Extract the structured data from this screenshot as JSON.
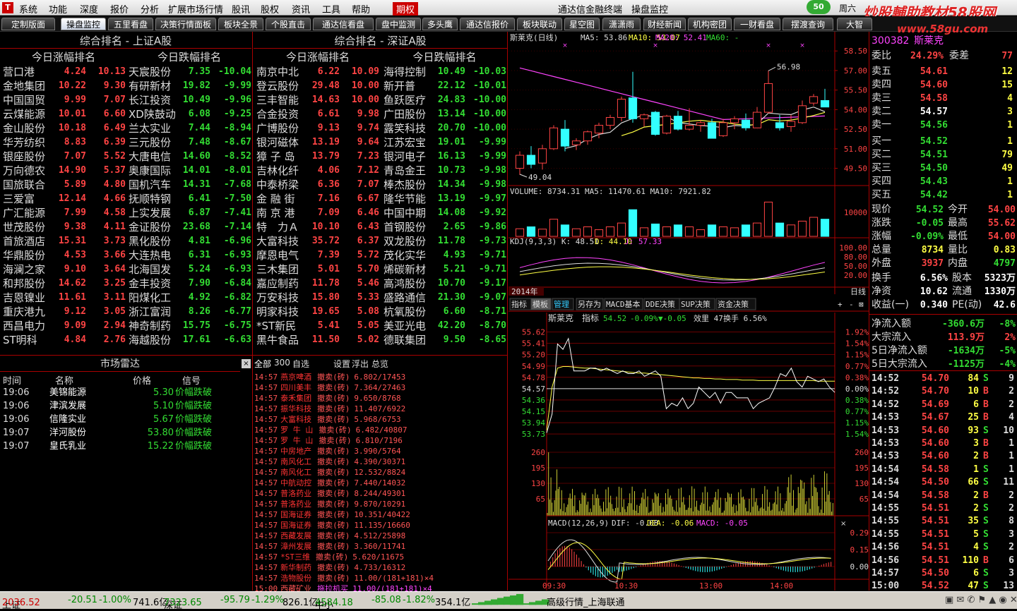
{
  "menu": {
    "items": [
      "系统",
      "功能",
      "深度",
      "报价",
      "分析",
      "扩展市场行情",
      "股讯",
      "股权",
      "资讯",
      "工具",
      "帮助",
      "期权"
    ],
    "app_title": "通达信金融终端",
    "module_title": "操盘监控",
    "weekday": "周六",
    "badge": "50"
  },
  "watermark": {
    "line1": "炒股輔助教材58股网",
    "line2": "www.58gu.com"
  },
  "tabs": [
    "定制版面",
    "操盘监控",
    "五里看盘",
    "决策行情面板",
    "板块全景",
    "个股直击",
    "通达信看盘",
    "盘中监测",
    "多头鹰",
    "通达信报价",
    "板块联动",
    "星空图",
    "潇潇雨",
    "财经新闻",
    "机构密团",
    "一财看盘",
    "摆渡查询",
    "大智"
  ],
  "sh_panel": {
    "title": "综合排名 - 上证A股",
    "gainers_head": "今日涨幅排名",
    "losers_head": "今日跌幅排名",
    "gainers": [
      [
        "营口港",
        "4.24",
        "10.13"
      ],
      [
        "金地集团",
        "10.22",
        "9.30"
      ],
      [
        "中国国贸",
        "9.99",
        "7.07"
      ],
      [
        "云煤能源",
        "10.01",
        "6.60"
      ],
      [
        "金山股份",
        "10.18",
        "6.49"
      ],
      [
        "华芳纺织",
        "8.83",
        "6.39"
      ],
      [
        "银座股份",
        "7.07",
        "5.52"
      ],
      [
        "万向德农",
        "14.90",
        "5.37"
      ],
      [
        "国旅联合",
        "5.89",
        "4.80"
      ],
      [
        "三爱富",
        "12.14",
        "4.66"
      ],
      [
        "广汇能源",
        "7.99",
        "4.58"
      ],
      [
        "世茂股份",
        "9.38",
        "4.11"
      ],
      [
        "首旅酒店",
        "15.31",
        "3.73"
      ],
      [
        "华鼎股份",
        "4.53",
        "3.66"
      ],
      [
        "海澜之家",
        "9.10",
        "3.64"
      ],
      [
        "和邦股份",
        "14.62",
        "3.25"
      ],
      [
        "吉恩镍业",
        "11.61",
        "3.11"
      ],
      [
        "重庆港九",
        "9.12",
        "3.05"
      ],
      [
        "西昌电力",
        "9.09",
        "2.94"
      ],
      [
        "ST明科",
        "4.84",
        "2.76"
      ]
    ],
    "losers": [
      [
        "天宸股份",
        "7.35",
        "-10.04"
      ],
      [
        "有研新材",
        "19.82",
        "-9.99"
      ],
      [
        "长江投资",
        "10.49",
        "-9.96"
      ],
      [
        "XD陕鼓动",
        "6.08",
        "-9.25"
      ],
      [
        "兰太实业",
        "7.44",
        "-8.94"
      ],
      [
        "三元股份",
        "7.48",
        "-8.67"
      ],
      [
        "大唐电信",
        "14.60",
        "-8.52"
      ],
      [
        "奥康国际",
        "14.01",
        "-8.01"
      ],
      [
        "国机汽车",
        "14.31",
        "-7.68"
      ],
      [
        "抚顺特钢",
        "6.41",
        "-7.50"
      ],
      [
        "上实发展",
        "6.87",
        "-7.41"
      ],
      [
        "金证股份",
        "23.68",
        "-7.14"
      ],
      [
        "黑化股份",
        "4.81",
        "-6.96"
      ],
      [
        "大连热电",
        "6.31",
        "-6.93"
      ],
      [
        "北海国发",
        "5.24",
        "-6.93"
      ],
      [
        "金丰投资",
        "7.90",
        "-6.84"
      ],
      [
        "阳煤化工",
        "4.92",
        "-6.82"
      ],
      [
        "浙江富润",
        "8.26",
        "-6.77"
      ],
      [
        "神奇制药",
        "15.75",
        "-6.75"
      ],
      [
        "海越股份",
        "17.61",
        "-6.63"
      ]
    ]
  },
  "sz_panel": {
    "title": "综合排名 - 深证A股",
    "gainers_head": "今日涨幅排名",
    "losers_head": "今日跌幅排名",
    "gainers": [
      [
        "南京中北",
        "6.22",
        "10.09"
      ],
      [
        "登云股份",
        "29.48",
        "10.00"
      ],
      [
        "三丰智能",
        "14.63",
        "10.00"
      ],
      [
        "合金投资",
        "6.61",
        "9.98"
      ],
      [
        "广博股份",
        "9.13",
        "9.74"
      ],
      [
        "银河磁体",
        "13.19",
        "9.64"
      ],
      [
        "獐 子 岛",
        "13.79",
        "7.23"
      ],
      [
        "吉林化纤",
        "4.06",
        "7.12"
      ],
      [
        "中泰桥梁",
        "6.36",
        "7.07"
      ],
      [
        "金 融 街",
        "7.16",
        "6.67"
      ],
      [
        "南 京 港",
        "7.09",
        "6.46"
      ],
      [
        "特　力Ａ",
        "10.10",
        "6.43"
      ],
      [
        "大富科技",
        "35.72",
        "6.37"
      ],
      [
        "摩恩电气",
        "7.39",
        "5.72"
      ],
      [
        "三木集团",
        "5.01",
        "5.70"
      ],
      [
        "嘉应制药",
        "11.78",
        "5.46"
      ],
      [
        "万安科技",
        "15.80",
        "5.33"
      ],
      [
        "明家科技",
        "19.65",
        "5.08"
      ],
      [
        "*ST新民",
        "5.41",
        "5.05"
      ],
      [
        "黑牛食品",
        "11.50",
        "5.02"
      ]
    ],
    "losers": [
      [
        "海得控制",
        "10.49",
        "-10.03"
      ],
      [
        "新开普",
        "22.12",
        "-10.01"
      ],
      [
        "鱼跃医疗",
        "24.83",
        "-10.00"
      ],
      [
        "广田股份",
        "13.14",
        "-10.00"
      ],
      [
        "露笑科技",
        "20.70",
        "-10.00"
      ],
      [
        "江苏宏宝",
        "19.01",
        "-9.99"
      ],
      [
        "银河电子",
        "16.13",
        "-9.99"
      ],
      [
        "青岛金王",
        "10.73",
        "-9.98"
      ],
      [
        "棒杰股份",
        "14.34",
        "-9.98"
      ],
      [
        "隆华节能",
        "13.19",
        "-9.97"
      ],
      [
        "中国中期",
        "14.08",
        "-9.92"
      ],
      [
        "首钢股份",
        "2.65",
        "-9.86"
      ],
      [
        "双龙股份",
        "11.78",
        "-9.73"
      ],
      [
        "茂化实华",
        "4.93",
        "-9.71"
      ],
      [
        "烯碳新材",
        "5.21",
        "-9.71"
      ],
      [
        "高鸿股份",
        "10.70",
        "-9.17"
      ],
      [
        "盛路通信",
        "21.30",
        "-9.07"
      ],
      [
        "杭氧股份",
        "6.60",
        "-8.71"
      ],
      [
        "美亚光电",
        "42.20",
        "-8.70"
      ],
      [
        "德联集团",
        "9.50",
        "-8.65"
      ]
    ]
  },
  "radar": {
    "title": "市场雷达",
    "headers": [
      "时间",
      "名称",
      "价格",
      "信号"
    ],
    "rows": [
      [
        "19:06",
        "美锦能源",
        "5.30",
        "价幅跌破"
      ],
      [
        "19:06",
        "津滨发展",
        "5.10",
        "价幅跌破"
      ],
      [
        "19:06",
        "信隆实业",
        "5.67",
        "价幅跌破"
      ],
      [
        "19:07",
        "洋河股份",
        "53.80",
        "价幅跌破"
      ],
      [
        "19:07",
        "皇氏乳业",
        "15.22",
        "价幅跌破"
      ]
    ]
  },
  "tape": {
    "tabs": [
      "全部",
      "300",
      "自选",
      "设置",
      "浮出",
      "总览"
    ],
    "rows": [
      [
        "14:57",
        "燕京啤酒",
        "撤卖(砖)",
        "6.802/17453"
      ],
      [
        "14:57",
        "四川美丰",
        "撤卖(砖)",
        "7.364/27463"
      ],
      [
        "14:57",
        "泰禾集团",
        "撤卖(砖)",
        "9.650/8768"
      ],
      [
        "14:57",
        "振华科技",
        "撤卖(砖)",
        "11.407/6922"
      ],
      [
        "14:57",
        "大富科技",
        "撤卖(砖)",
        "5.968/6753"
      ],
      [
        "14:57",
        "罗 牛 山",
        "撤卖(砖)",
        "6.482/40807"
      ],
      [
        "14:57",
        "罗 牛 山",
        "撤卖(砖)",
        "6.810/7196"
      ],
      [
        "14:57",
        "中房地产",
        "撤卖(砖)",
        "3.990/5764"
      ],
      [
        "14:57",
        "南风化工",
        "撤卖(砖)",
        "4.390/30371"
      ],
      [
        "14:57",
        "南风化工",
        "撤卖(砖)",
        "12.532/8824"
      ],
      [
        "14:57",
        "中航动控",
        "撤卖(砖)",
        "7.440/14032"
      ],
      [
        "14:57",
        "普洛药业",
        "撤卖(砖)",
        "8.244/49301"
      ],
      [
        "14:57",
        "普洛药业",
        "撤卖(砖)",
        "9.870/10291"
      ],
      [
        "14:57",
        "国海证券",
        "撤卖(砖)",
        "10.351/40422"
      ],
      [
        "14:57",
        "国海证券",
        "撤卖(砖)",
        "11.135/16660"
      ],
      [
        "14:57",
        "西藏发展",
        "撤卖(砖)",
        "4.512/25898"
      ],
      [
        "14:57",
        "漳州发展",
        "撤卖(砖)",
        "3.360/11741"
      ],
      [
        "14:57",
        "*ST三维",
        "撤卖(砖)",
        "5.620/11675"
      ],
      [
        "14:57",
        "新华制药",
        "撤卖(砖)",
        "4.733/16312"
      ],
      [
        "14:57",
        "浩物股份",
        "撤卖(砖)",
        "11.00/(181+181)×4"
      ],
      [
        "15:00",
        "西藏矿业",
        "拖拉机买",
        "11.00/(181+181)×4"
      ]
    ]
  },
  "kline": {
    "header_name": "斯莱克(日线)",
    "ma5": "MA5: 53.86",
    "ma10": "MA10: 53.07",
    "ma20": "MA20: 52.41",
    "ma60": "MA60: -",
    "high_label": "56.98",
    "low_label": "49.04",
    "y_ticks": [
      "58.50",
      "57.00",
      "55.50",
      "54.00",
      "52.50",
      "51.00",
      "49.50"
    ],
    "candles": [
      [
        49.5,
        50.8,
        49.0,
        50.5
      ],
      [
        50.5,
        51.2,
        49.5,
        49.8
      ],
      [
        49.9,
        51.3,
        49.4,
        51.0
      ],
      [
        51.0,
        52.8,
        50.9,
        52.6
      ],
      [
        52.5,
        53.2,
        50.8,
        51.2
      ],
      [
        51.3,
        51.8,
        50.9,
        51.6
      ],
      [
        51.6,
        52.4,
        51.3,
        52.3
      ],
      [
        52.2,
        53.0,
        51.8,
        52.8
      ],
      [
        52.8,
        53.6,
        52.5,
        53.4
      ],
      [
        53.4,
        55.0,
        53.1,
        54.8
      ],
      [
        54.9,
        56.9,
        53.0,
        53.3
      ],
      [
        53.3,
        53.7,
        52.7,
        53.6
      ],
      [
        53.8,
        53.9,
        52.0,
        52.1
      ],
      [
        52.2,
        53.6,
        52.1,
        53.5
      ],
      [
        53.5,
        53.9,
        52.4,
        52.5
      ],
      [
        52.5,
        54.1,
        52.4,
        52.8
      ],
      [
        52.8,
        53.2,
        52.3,
        53.0
      ],
      [
        53.0,
        53.3,
        51.8,
        51.8
      ],
      [
        52.0,
        53.3,
        51.9,
        53.0
      ],
      [
        53.0,
        53.5,
        52.5,
        53.3
      ],
      [
        53.2,
        53.7,
        52.4,
        52.6
      ],
      [
        52.6,
        54.2,
        52.6,
        53.8
      ],
      [
        53.8,
        57.0,
        53.7,
        56.0
      ],
      [
        53.0,
        53.6,
        52.4,
        52.6
      ],
      [
        52.7,
        53.6,
        52.3,
        53.1
      ],
      [
        53.0,
        54.7,
        52.9,
        54.3
      ],
      [
        54.5,
        55.2,
        54.3,
        55.0
      ],
      [
        54.7,
        55.6,
        54.2,
        54.2
      ]
    ],
    "vol_header": "VOLUME: 8734.31  MA5: 11470.61  MA10: 7921.82",
    "vol_tick": "10000",
    "volumes": [
      4000,
      5000,
      3800,
      9000,
      6000,
      4000,
      5000,
      3500,
      5000,
      7000,
      14000,
      4500,
      6500,
      5000,
      6000,
      5000,
      3500,
      6000,
      5000,
      4500,
      6000,
      7000,
      18000,
      7000,
      6000,
      8000,
      10000,
      9000
    ],
    "kdj_header_k": "KDJ(9,3,3)  K: 48.51",
    "kdj_header_d": "D: 44.10",
    "kdj_header_j": "J: 57.33",
    "kdj_ticks": [
      "100.00",
      "80.00",
      "50.00",
      "20.00"
    ],
    "year_label": "2014年",
    "period": "日线"
  },
  "bottom_tabs": [
    "指标",
    "模板",
    "管理",
    "另存为",
    "MACD基本",
    "DDE决策",
    "SUP决策",
    "资金决策"
  ],
  "intraday": {
    "name": "斯莱克",
    "label": "指标",
    "price": "54.52",
    "chg": "-0.09%",
    "delta": "▼-0.05",
    "vr": "效里 47",
    "turn": "换手 6.56%",
    "left_ticks": [
      "55.62",
      "55.41",
      "55.20",
      "54.99",
      "54.78",
      "54.57",
      "54.36",
      "54.15",
      "53.94",
      "53.73"
    ],
    "right_ticks": [
      "1.92%",
      "1.54%",
      "1.15%",
      "0.77%",
      "0.38%",
      "0.00%",
      "0.38%",
      "0.77%",
      "1.15%",
      "1.54%"
    ],
    "vol_ticks": [
      "260",
      "195",
      "130",
      "65"
    ],
    "macd_header": "MACD(12,26,9)",
    "macd_dif": "DIF: -0.08",
    "macd_dea": "DEA: -0.06",
    "macd_val": "MACD: -0.05",
    "macd_ticks": [
      "0.29",
      "0.15",
      "0.00"
    ],
    "time_ticks": [
      "09:30",
      "10:30",
      "13:00",
      "14:00"
    ],
    "price_series": [
      53.75,
      54.1,
      55.4,
      55.3,
      55.5,
      54.9,
      54.9,
      54.9,
      54.95,
      54.95,
      54.9,
      54.95,
      54.9,
      54.85,
      54.9,
      54.85,
      54.85,
      54.9,
      54.8,
      54.85,
      54.9,
      54.8,
      54.2,
      54.3,
      54.25,
      54.4,
      54.2,
      54.3,
      54.6,
      54.5,
      54.4,
      54.5,
      54.3,
      54.5,
      54.5,
      54.4,
      54.4,
      54.4,
      54.2,
      54.3,
      54.35,
      54.4,
      54.6,
      54.85,
      54.8,
      54.95,
      54.7,
      54.6,
      54.8,
      54.75,
      54.7,
      54.75,
      54.6,
      54.5
    ],
    "avg_series": [
      53.8,
      54.6,
      54.95,
      54.98,
      54.98,
      54.97,
      54.96,
      54.95,
      54.95,
      54.94,
      54.93,
      54.92,
      54.91,
      54.9,
      54.89,
      54.88,
      54.87,
      54.86,
      54.86,
      54.85,
      54.84,
      54.83,
      54.82,
      54.81,
      54.8,
      54.79,
      54.78,
      54.77,
      54.77,
      54.76,
      54.76,
      54.75,
      54.75,
      54.74,
      54.74,
      54.74,
      54.73,
      54.73,
      54.73,
      54.72,
      54.72,
      54.72,
      54.72,
      54.72,
      54.72,
      54.72,
      54.72,
      54.72,
      54.72,
      54.72,
      54.71,
      54.71,
      54.71,
      54.71
    ]
  },
  "quote": {
    "code": "300382",
    "name": "斯莱克",
    "webi_label": "委比",
    "webi": "24.29%",
    "weicha_label": "委差",
    "weicha": "77",
    "asks": [
      [
        "卖五",
        "54.61",
        "12"
      ],
      [
        "卖四",
        "54.60",
        "15"
      ],
      [
        "卖三",
        "54.58",
        "4"
      ],
      [
        "卖二",
        "54.57",
        "3"
      ],
      [
        "卖一",
        "54.56",
        "1"
      ]
    ],
    "bids": [
      [
        "买一",
        "54.52",
        "1"
      ],
      [
        "买二",
        "54.51",
        "79"
      ],
      [
        "买三",
        "54.50",
        "49"
      ],
      [
        "买四",
        "54.43",
        "1"
      ],
      [
        "买五",
        "54.42",
        "1"
      ]
    ],
    "stats": [
      [
        "现价",
        "54.52",
        "今开",
        "54.00"
      ],
      [
        "涨跌",
        "-0.05",
        "最高",
        "55.62"
      ],
      [
        "涨幅",
        "-0.09%",
        "最低",
        "54.00"
      ],
      [
        "总量",
        "8734",
        "量比",
        "0.83"
      ],
      [
        "外盘",
        "3937",
        "内盘",
        "4797"
      ]
    ],
    "stats2": [
      [
        "换手",
        "6.56%",
        "股本",
        "5323万"
      ],
      [
        "净资",
        "10.62",
        "流通",
        "1330万"
      ],
      [
        "收益(一)",
        "0.340",
        "PE(动)",
        "42.6"
      ]
    ],
    "flows": [
      [
        "净流入额",
        "-360.6万",
        "-8%"
      ],
      [
        "大宗流入",
        "113.9万",
        "2%"
      ],
      [
        "5日净流入额",
        "-1634万",
        "-5%"
      ],
      [
        "5日大宗流入",
        "-1125万",
        "-4%"
      ]
    ],
    "trades": [
      [
        "14:52",
        "54.70",
        "84",
        "S",
        "9"
      ],
      [
        "14:52",
        "54.70",
        "10",
        "B",
        "2"
      ],
      [
        "14:52",
        "54.69",
        "6",
        "B",
        "2"
      ],
      [
        "14:53",
        "54.67",
        "25",
        "B",
        "4"
      ],
      [
        "14:53",
        "54.60",
        "93",
        "S",
        "10"
      ],
      [
        "14:53",
        "54.60",
        "3",
        "B",
        "1"
      ],
      [
        "14:53",
        "54.60",
        "2",
        "B",
        "1"
      ],
      [
        "14:54",
        "54.58",
        "1",
        "S",
        "1"
      ],
      [
        "14:54",
        "54.50",
        "66",
        "S",
        "11"
      ],
      [
        "14:54",
        "54.58",
        "2",
        "B",
        "2"
      ],
      [
        "14:55",
        "54.51",
        "2",
        "S",
        "2"
      ],
      [
        "14:55",
        "54.51",
        "35",
        "S",
        "8"
      ],
      [
        "14:55",
        "54.51",
        "5",
        "S",
        "3"
      ],
      [
        "14:56",
        "54.51",
        "4",
        "S",
        "2"
      ],
      [
        "14:56",
        "54.51",
        "110",
        "B",
        "6"
      ],
      [
        "14:57",
        "54.50",
        "6",
        "S",
        "3"
      ],
      [
        "15:00",
        "54.52",
        "47",
        "S",
        "13"
      ]
    ]
  },
  "status": {
    "sh": "上证",
    "sh_val": "2036.52",
    "sh_chg": "-20.51",
    "sh_pct": "-1.00%",
    "sh_amt": "741.6亿",
    "sz": "深证",
    "sz_val": "7323.65",
    "sz_chg": "-95.79",
    "sz_pct": "-1.29%",
    "sz_amt": "826.1亿",
    "zx": "中小",
    "zx_val": "4584.18",
    "zx_chg": "-85.08",
    "zx_pct": "-1.82%",
    "zx_amt": "354.1亿",
    "feed": "高级行情_上海联通"
  },
  "colors": {
    "up": "#ff4444",
    "down": "#33dd33",
    "grid": "#aa0000",
    "bg": "#000000"
  }
}
